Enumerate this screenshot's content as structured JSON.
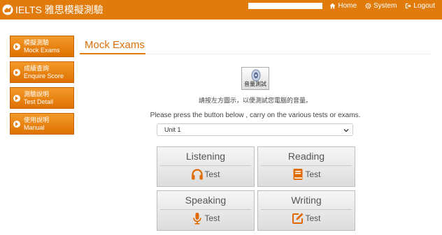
{
  "header": {
    "brand": "IELTS 雅思模擬測驗",
    "nav": [
      {
        "label": "Home",
        "icon": "home-icon"
      },
      {
        "label": "System",
        "icon": "gear-icon"
      },
      {
        "label": "Logout",
        "icon": "logout-icon"
      }
    ]
  },
  "sidebar": {
    "items": [
      {
        "zh": "模擬測驗",
        "en": "Mock Exams"
      },
      {
        "zh": "成績查詢",
        "en": "Enquire Score"
      },
      {
        "zh": "測驗說明",
        "en": "Test Detail"
      },
      {
        "zh": "使用說明",
        "en": "Manual"
      }
    ]
  },
  "main": {
    "title": "Mock Exams",
    "sound_test_label": "音量測試",
    "sound_hint": "請按左方圖示，以便測試您電腦的音量。",
    "instruction": "Please press the button below , carry on the various tests or exams.",
    "unit_select": {
      "value": "Unit 1"
    },
    "tests": [
      {
        "title": "Listening",
        "action": "Test",
        "icon": "headphones-icon"
      },
      {
        "title": "Reading",
        "action": "Test",
        "icon": "book-icon"
      },
      {
        "title": "Speaking",
        "action": "Test",
        "icon": "microphone-icon"
      },
      {
        "title": "Writing",
        "action": "Test",
        "icon": "edit-icon"
      }
    ]
  },
  "colors": {
    "brand_orange": "#e07b0c",
    "title_orange": "#d86f0a",
    "icon_orange": "#e06a00"
  }
}
